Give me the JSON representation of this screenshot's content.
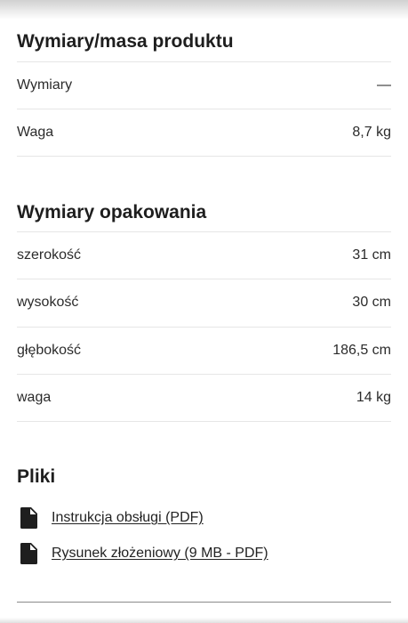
{
  "product_dimensions": {
    "title": "Wymiary/masa produktu",
    "rows": [
      {
        "label": "Wymiary",
        "value": "—"
      },
      {
        "label": "Waga",
        "value": "8,7 kg"
      }
    ]
  },
  "package_dimensions": {
    "title": "Wymiary opakowania",
    "rows": [
      {
        "label": "szerokość",
        "value": "31 cm"
      },
      {
        "label": "wysokość",
        "value": "30 cm"
      },
      {
        "label": "głębokość",
        "value": "186,5 cm"
      },
      {
        "label": "waga",
        "value": "14 kg"
      }
    ]
  },
  "files": {
    "title": "Pliki",
    "items": [
      {
        "label": "Instrukcja obsługi (PDF)",
        "icon": "file-icon"
      },
      {
        "label": "Rysunek złożeniowy (9 MB - PDF)",
        "icon": "file-icon"
      }
    ]
  }
}
